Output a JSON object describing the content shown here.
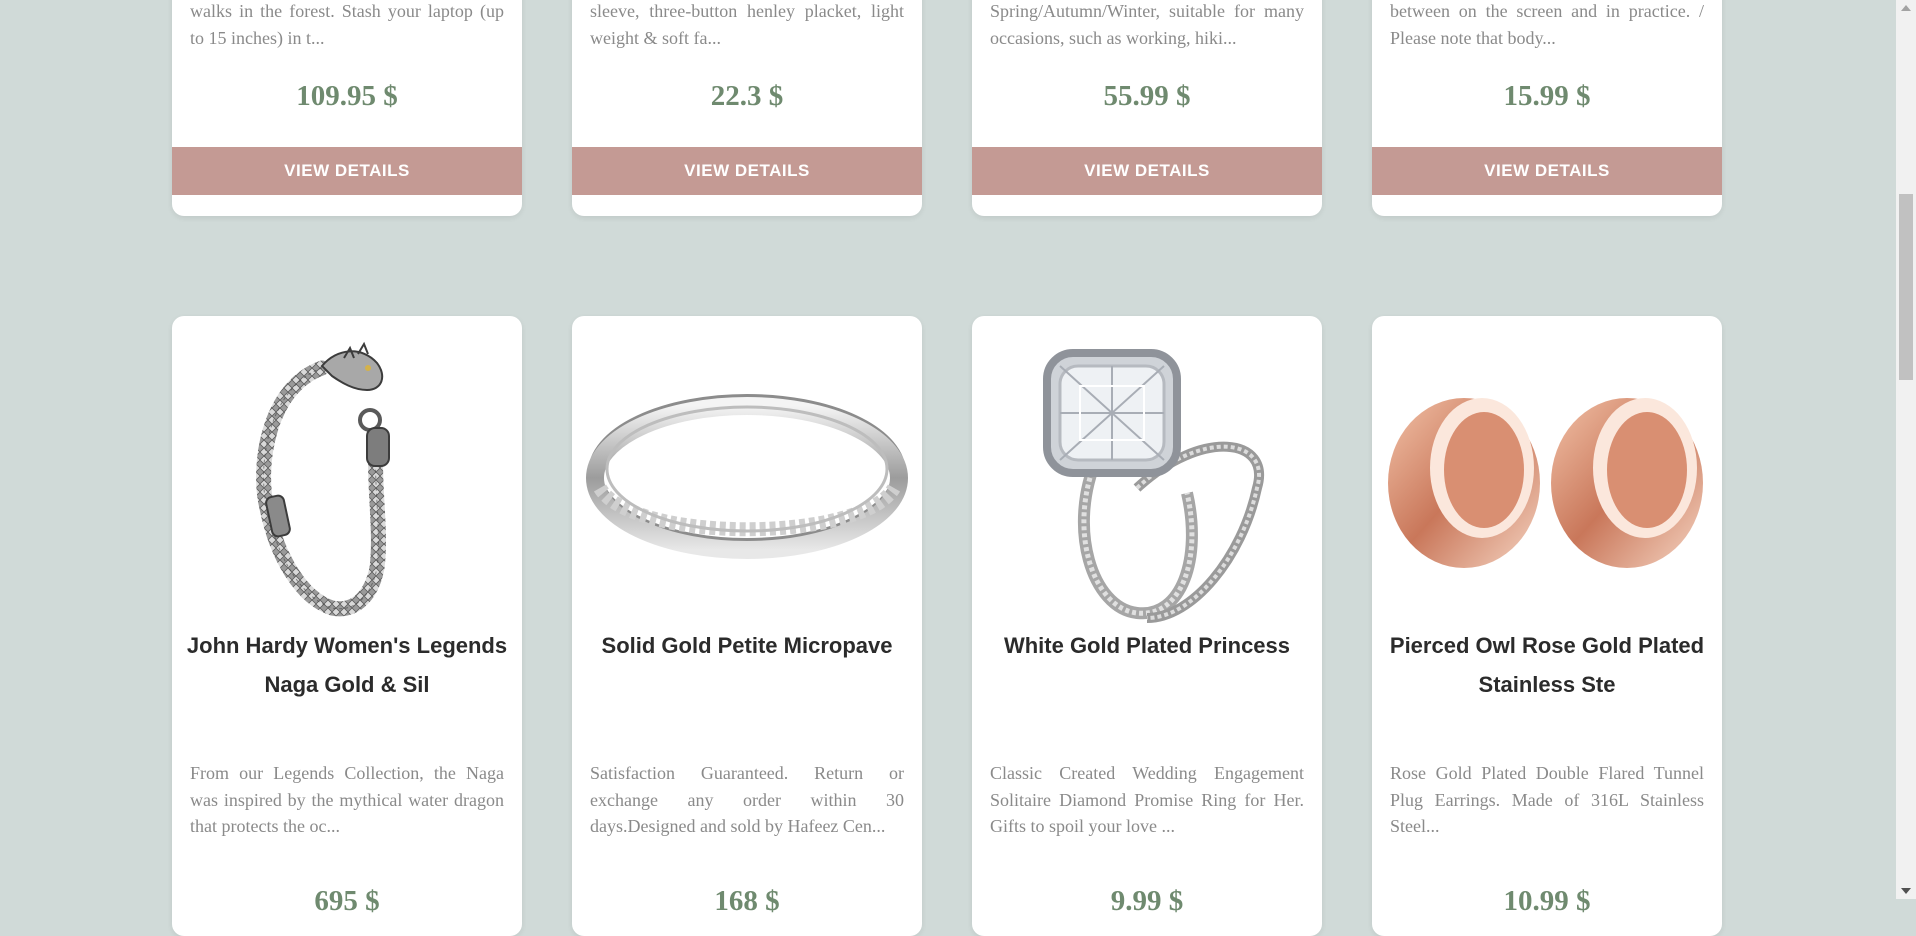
{
  "products_row_1": [
    {
      "description": "walks in the forest. Stash your laptop (up to 15 inches) in t...",
      "price": "109.95 $",
      "button_label": "VIEW DETAILS"
    },
    {
      "description": "sleeve, three-button henley placket, light weight & soft fa...",
      "price": "22.3 $",
      "button_label": "VIEW DETAILS"
    },
    {
      "description": "Spring/Autumn/Winter, suitable for many occasions, such as working, hiki...",
      "price": "55.99 $",
      "button_label": "VIEW DETAILS"
    },
    {
      "description": "between on the screen and in practice. / Please note that body...",
      "price": "15.99 $",
      "button_label": "VIEW DETAILS"
    }
  ],
  "products_row_2": [
    {
      "title": "John Hardy Women's Legends Naga Gold & Sil",
      "description": "From our Legends Collection, the Naga was inspired by the mythical water dragon that protects the oc...",
      "price": "695 $",
      "image": "silver-dragon-bracelet"
    },
    {
      "title": "Solid Gold Petite Micropave",
      "description": "Satisfaction Guaranteed. Return or exchange any order within 30 days.Designed and sold by Hafeez Cen...",
      "price": "168 $",
      "image": "silver-micropave-ring"
    },
    {
      "title": "White Gold Plated Princess",
      "description": "Classic Created Wedding Engagement Solitaire Diamond Promise Ring for Her. Gifts to spoil your love ...",
      "price": "9.99 $",
      "image": "diamond-engagement-ring-set"
    },
    {
      "title": "Pierced Owl Rose Gold Plated Stainless Ste",
      "description": "Rose Gold Plated Double Flared Tunnel Plug Earrings. Made of 316L Stainless Steel...",
      "price": "10.99 $",
      "image": "rose-gold-tunnel-plugs"
    }
  ],
  "colors": {
    "background": "#d0dad8",
    "card": "#ffffff",
    "button": "#c49a94",
    "price": "#6f8a6f"
  }
}
